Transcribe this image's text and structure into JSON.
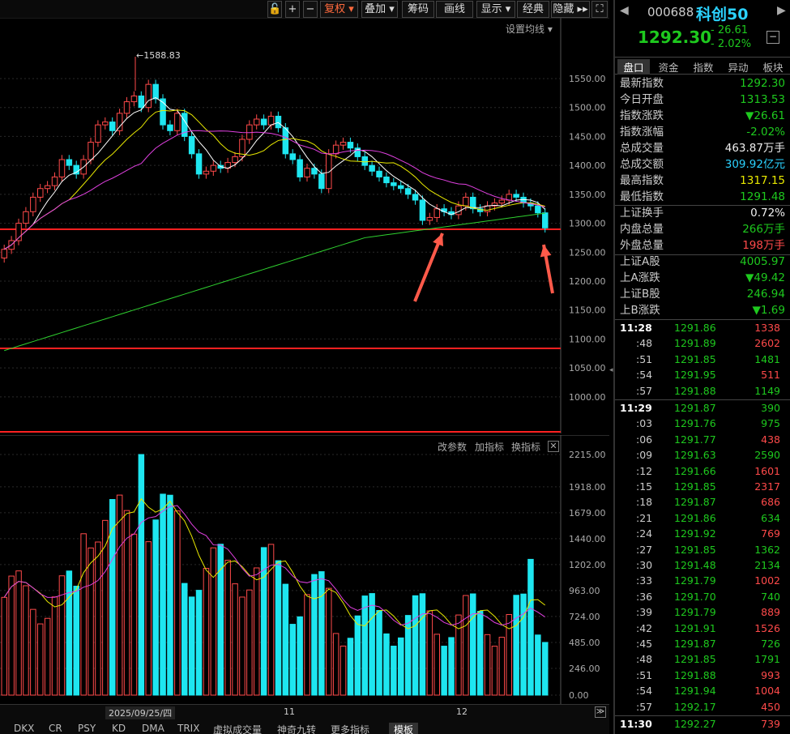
{
  "toolbar": {
    "items": [
      {
        "id": "lock",
        "label": "🔓"
      },
      {
        "id": "plus",
        "label": "+"
      },
      {
        "id": "minus",
        "label": "−"
      },
      {
        "id": "fuquan",
        "label": "复权 ▾",
        "active": true
      },
      {
        "id": "diejia",
        "label": "叠加 ▾"
      },
      {
        "id": "chouma",
        "label": "筹码"
      },
      {
        "id": "huaxian",
        "label": "画线"
      },
      {
        "id": "xianshi",
        "label": "显示 ▾"
      },
      {
        "id": "jingdian",
        "label": "经典"
      },
      {
        "id": "yincang",
        "label": "隐藏 ▸▸"
      },
      {
        "id": "fullscreen",
        "label": "⛶"
      }
    ]
  },
  "main": {
    "ma_settings": "设置均线 ▾",
    "high_label": "←1588.83",
    "y_ticks": [
      "1550.00",
      "1500.00",
      "1450.00",
      "1400.00",
      "1350.00",
      "1300.00",
      "1250.00",
      "1200.00",
      "1150.00",
      "1100.00",
      "1050.00",
      "1000.00"
    ]
  },
  "vol": {
    "links": [
      "改参数",
      "加指标",
      "换指标"
    ],
    "y_ticks": [
      "2215.00",
      "1918.00",
      "1679.00",
      "1440.00",
      "1202.00",
      "963.00",
      "724.00",
      "485.00",
      "246.00",
      "0.00"
    ]
  },
  "xaxis": {
    "date_label": "2025/09/25/四",
    "m11": "11",
    "m12": "12"
  },
  "bottom_tabs": [
    "DKX",
    "CR",
    "PSY",
    "KD",
    "DMA",
    "TRIX",
    "虚拟成交量",
    "神奇九转",
    "更多指标",
    "模板"
  ],
  "quote": {
    "code": "000688",
    "name": "科创50",
    "price": "1292.30",
    "change": "- 26.61",
    "pct": "- 2.02%"
  },
  "panel_tabs": [
    "盘口",
    "资金",
    "指数",
    "异动",
    "板块"
  ],
  "stats": [
    {
      "label": "最新指数",
      "value": "1292.30",
      "color": "g"
    },
    {
      "label": "今日开盘",
      "value": "1313.53",
      "color": "g"
    },
    {
      "label": "指数涨跌",
      "value": "▼26.61",
      "color": "g"
    },
    {
      "label": "指数涨幅",
      "value": "-2.02%",
      "color": "g"
    },
    {
      "label": "总成交量",
      "value": "463.87万手",
      "color": "w"
    },
    {
      "label": "总成交额",
      "value": "309.92亿元",
      "color": "c"
    },
    {
      "label": "最高指数",
      "value": "1317.15",
      "color": "y"
    },
    {
      "label": "最低指数",
      "value": "1291.48",
      "color": "g"
    }
  ],
  "stats2": [
    {
      "label": "上证换手",
      "value": "0.72%",
      "color": "w"
    },
    {
      "label": "内盘总量",
      "value": "266万手",
      "color": "g"
    },
    {
      "label": "外盘总量",
      "value": "198万手",
      "color": "r"
    }
  ],
  "stats3": [
    {
      "label": "上证A股",
      "value": "4005.97",
      "color": "g"
    },
    {
      "label": "上A涨跌",
      "value": "▼49.42",
      "color": "g"
    },
    {
      "label": "上证B股",
      "value": "246.94",
      "color": "g"
    },
    {
      "label": "上B涨跌",
      "value": "▼1.69",
      "color": "g"
    }
  ],
  "ticks": [
    {
      "t": "11:28",
      "p": "1291.86",
      "q": "1338",
      "c": "r",
      "bold": true
    },
    {
      "t": ":48",
      "p": "1291.89",
      "q": "2602",
      "c": "r"
    },
    {
      "t": ":51",
      "p": "1291.85",
      "q": "1481",
      "c": "g"
    },
    {
      "t": ":54",
      "p": "1291.95",
      "q": "511",
      "c": "r"
    },
    {
      "t": ":57",
      "p": "1291.88",
      "q": "1149",
      "c": "g"
    },
    {
      "t": "11:29",
      "p": "1291.87",
      "q": "390",
      "c": "g",
      "bold": true
    },
    {
      "t": ":03",
      "p": "1291.76",
      "q": "975",
      "c": "g"
    },
    {
      "t": ":06",
      "p": "1291.77",
      "q": "438",
      "c": "r"
    },
    {
      "t": ":09",
      "p": "1291.63",
      "q": "2590",
      "c": "g"
    },
    {
      "t": ":12",
      "p": "1291.66",
      "q": "1601",
      "c": "r"
    },
    {
      "t": ":15",
      "p": "1291.85",
      "q": "2317",
      "c": "r"
    },
    {
      "t": ":18",
      "p": "1291.87",
      "q": "686",
      "c": "r"
    },
    {
      "t": ":21",
      "p": "1291.86",
      "q": "634",
      "c": "g"
    },
    {
      "t": ":24",
      "p": "1291.92",
      "q": "769",
      "c": "r"
    },
    {
      "t": ":27",
      "p": "1291.85",
      "q": "1362",
      "c": "g"
    },
    {
      "t": ":30",
      "p": "1291.48",
      "q": "2134",
      "c": "g"
    },
    {
      "t": ":33",
      "p": "1291.79",
      "q": "1002",
      "c": "r"
    },
    {
      "t": ":36",
      "p": "1291.70",
      "q": "740",
      "c": "g"
    },
    {
      "t": ":39",
      "p": "1291.79",
      "q": "889",
      "c": "r"
    },
    {
      "t": ":42",
      "p": "1291.91",
      "q": "1526",
      "c": "r"
    },
    {
      "t": ":45",
      "p": "1291.87",
      "q": "726",
      "c": "g"
    },
    {
      "t": ":48",
      "p": "1291.85",
      "q": "1791",
      "c": "g"
    },
    {
      "t": ":51",
      "p": "1291.88",
      "q": "993",
      "c": "r"
    },
    {
      "t": ":54",
      "p": "1291.94",
      "q": "1004",
      "c": "r"
    },
    {
      "t": ":57",
      "p": "1292.17",
      "q": "450",
      "c": "r"
    },
    {
      "t": "11:30",
      "p": "1292.27",
      "q": "739",
      "c": "r",
      "bold": true
    }
  ],
  "colors": {
    "up": "#ff4a4a",
    "down": "#1ee6f0",
    "ma5": "#ffffff",
    "ma10": "#e8e800",
    "ma20": "#e040e0",
    "ma60": "#2fd12f",
    "redline": "#ff2020",
    "arrow": "#ff5a4a"
  }
}
